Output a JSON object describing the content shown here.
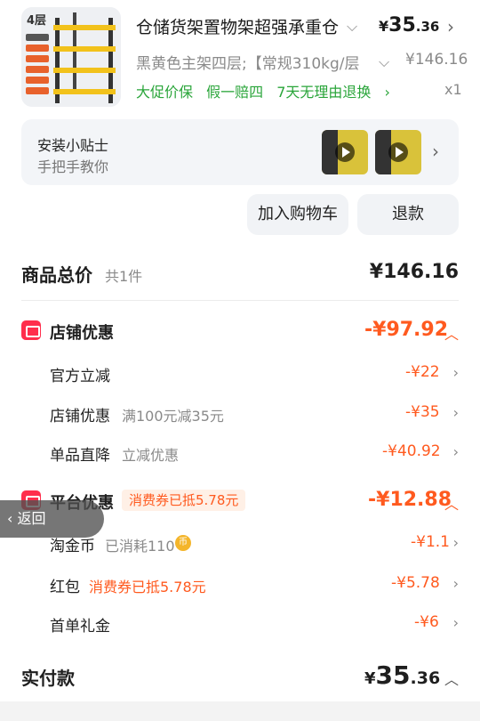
{
  "product": {
    "thumb_badge": "4层",
    "title": "仓储货架置物架超强承重仓库货架",
    "price_main": "35",
    "price_dec": ".36",
    "spec": "黑黄色主架四层;【常规310kg/层",
    "orig_price": "¥146.16",
    "services": [
      "大促价保",
      "假一赔四",
      "7天无理由退换"
    ],
    "qty": "x1"
  },
  "tips": {
    "title": "安装小贴士",
    "subtitle": "手把手教你"
  },
  "buttons": {
    "cart": "加入购物车",
    "refund": "退款"
  },
  "summary": {
    "label": "商品总价",
    "count": "共1件",
    "total": "¥146.16"
  },
  "store_discount": {
    "label": "店铺优惠",
    "amount": "-¥97.92",
    "rows": [
      {
        "label": "官方立减",
        "sub": "",
        "amount": "-¥22"
      },
      {
        "label": "店铺优惠",
        "sub": "满100元减35元",
        "amount": "-¥35"
      },
      {
        "label": "单品直降",
        "sub": "立减优惠",
        "amount": "-¥40.92"
      }
    ]
  },
  "platform_discount": {
    "label": "平台优惠",
    "coupon": "消费券已抵5.78元",
    "amount": "-¥12.88",
    "rows": [
      {
        "label": "淘金币",
        "sub": "已消耗110",
        "amount": "-¥1.1"
      },
      {
        "label": "红包",
        "sub": "消费券已抵5.78元",
        "amount": "-¥5.78"
      },
      {
        "label": "首单礼金",
        "sub": "",
        "amount": "-¥6"
      }
    ]
  },
  "back_label": "返回",
  "payment": {
    "label": "实付款",
    "price_main": "35",
    "price_dec": ".36"
  },
  "colors": {
    "accent": "#ff5a1f",
    "green": "#2aa53a",
    "red": "#ff2e4c"
  }
}
